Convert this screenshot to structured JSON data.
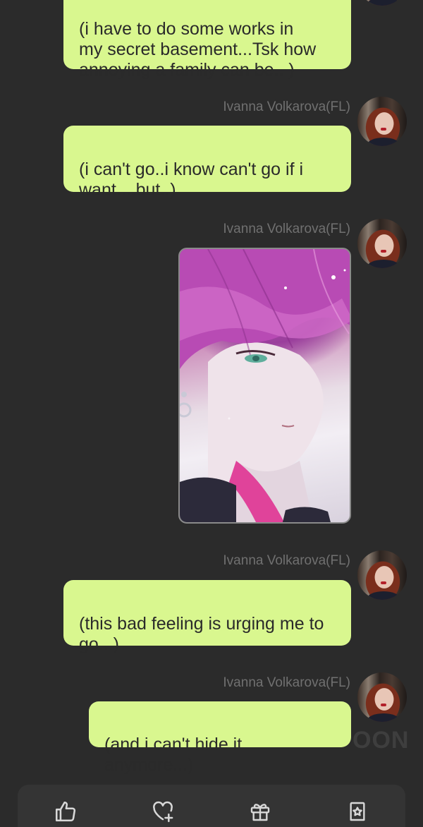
{
  "messages": [
    {
      "type": "text",
      "sender": "",
      "text": "(i have to do some works in\nmy secret basement...Tsk how\nannoying a family can be.. )"
    },
    {
      "type": "text",
      "sender": "Ivanna Volkarova(FL)",
      "text": "(i can't go..i know can't go if i\nwant....but..)"
    },
    {
      "type": "image",
      "sender": "Ivanna Volkarova(FL)",
      "image_description": "anime illustration, pink-haired character profile"
    },
    {
      "type": "text",
      "sender": "Ivanna Volkarova(FL)",
      "text": "(this bad feeling is urging me to\ngo...)"
    },
    {
      "type": "text",
      "sender": "Ivanna Volkarova(FL)",
      "text": "(and i can't hide it anymore...)"
    }
  ],
  "watermark": "OON",
  "toolbar": {
    "icons": [
      "thumbs-up-icon",
      "heart-plus-icon",
      "gift-icon",
      "star-bookmark-icon"
    ]
  },
  "colors": {
    "background": "#2b2b2b",
    "bubble": "#d9f78f",
    "bubble_text": "#2a2a2a",
    "sender_text": "#707070",
    "toolbar": "#343434",
    "icon": "#d8d8d8"
  }
}
